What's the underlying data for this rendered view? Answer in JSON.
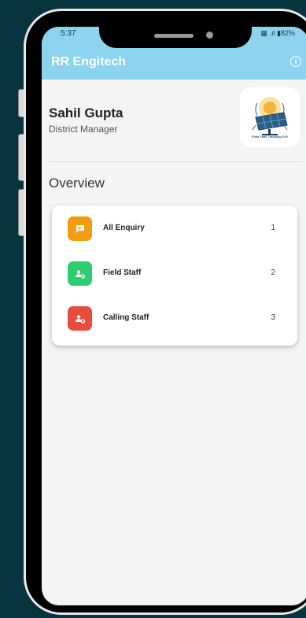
{
  "status_bar": {
    "time": "5:37",
    "indicators": "▦ .ıl ▮82%"
  },
  "app_bar": {
    "title": "RR Engitech",
    "icon": "info-icon"
  },
  "profile": {
    "name": "Sahil Gupta",
    "role": "District Manager",
    "logo_text": "Field Task Tracking SYS"
  },
  "overview": {
    "heading": "Overview",
    "items": [
      {
        "label": "All Enquiry",
        "count": "1",
        "icon": "chat-icon",
        "color": "#f39c12"
      },
      {
        "label": "Field Staff",
        "count": "2",
        "icon": "user-settings-icon",
        "color": "#2ecc71"
      },
      {
        "label": "Calling Staff",
        "count": "3",
        "icon": "user-settings-icon",
        "color": "#e74c3c"
      }
    ]
  }
}
